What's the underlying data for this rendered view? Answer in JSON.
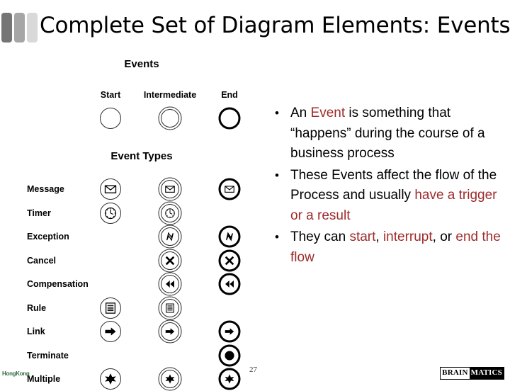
{
  "slide": {
    "title": "Complete Set of Diagram Elements: Events",
    "page_number": "27"
  },
  "diagram": {
    "events_heading": "Events",
    "event_types_heading": "Event Types",
    "columns": [
      {
        "key": "start",
        "label": "Start"
      },
      {
        "key": "intermediate",
        "label": "Intermediate"
      },
      {
        "key": "end",
        "label": "End"
      }
    ],
    "rows": [
      {
        "label": "Message",
        "icon": "envelope-icon",
        "start": true,
        "intermediate": true,
        "end": true
      },
      {
        "label": "Timer",
        "icon": "clock-icon",
        "start": true,
        "intermediate": true,
        "end": false
      },
      {
        "label": "Exception",
        "icon": "lightning-bolt-icon",
        "start": false,
        "intermediate": true,
        "end": true
      },
      {
        "label": "Cancel",
        "icon": "x-cross-icon",
        "start": false,
        "intermediate": true,
        "end": true
      },
      {
        "label": "Compensation",
        "icon": "rewind-icon",
        "start": false,
        "intermediate": true,
        "end": true
      },
      {
        "label": "Rule",
        "icon": "document-lines-icon",
        "start": true,
        "intermediate": true,
        "end": false
      },
      {
        "label": "Link",
        "icon": "right-arrow-icon",
        "start": true,
        "intermediate": true,
        "end": true
      },
      {
        "label": "Terminate",
        "icon": "filled-circle-icon",
        "start": false,
        "intermediate": false,
        "end": true
      },
      {
        "label": "Multiple",
        "icon": "star-icon",
        "start": true,
        "intermediate": true,
        "end": true
      }
    ]
  },
  "bullets": [
    {
      "marker": "•",
      "segments": [
        {
          "text": "An ",
          "highlight": false
        },
        {
          "text": "Event",
          "highlight": true
        },
        {
          "text": " is something that “happens” during the course of a business process",
          "highlight": false
        }
      ]
    },
    {
      "marker": "•",
      "segments": [
        {
          "text": "These Events affect the flow of the Process and usually ",
          "highlight": false
        },
        {
          "text": "have a trigger or a result",
          "highlight": true
        }
      ]
    },
    {
      "marker": "•",
      "segments": [
        {
          "text": "They can ",
          "highlight": false
        },
        {
          "text": "start",
          "highlight": true
        },
        {
          "text": ", ",
          "highlight": false
        },
        {
          "text": "interrupt",
          "highlight": true
        },
        {
          "text": ", or ",
          "highlight": false
        },
        {
          "text": "end the flow",
          "highlight": true
        }
      ]
    }
  ],
  "footer": {
    "watermark": "HongKong",
    "logo_part_one": "BRAIN",
    "logo_part_two": "MATICS"
  },
  "colors": {
    "highlight": "#9e2a2a",
    "title_block_dark": "#757575",
    "title_block_medium": "#a6a6a6",
    "title_block_light": "#d9d9d9",
    "watermark": "#2f6b43"
  }
}
